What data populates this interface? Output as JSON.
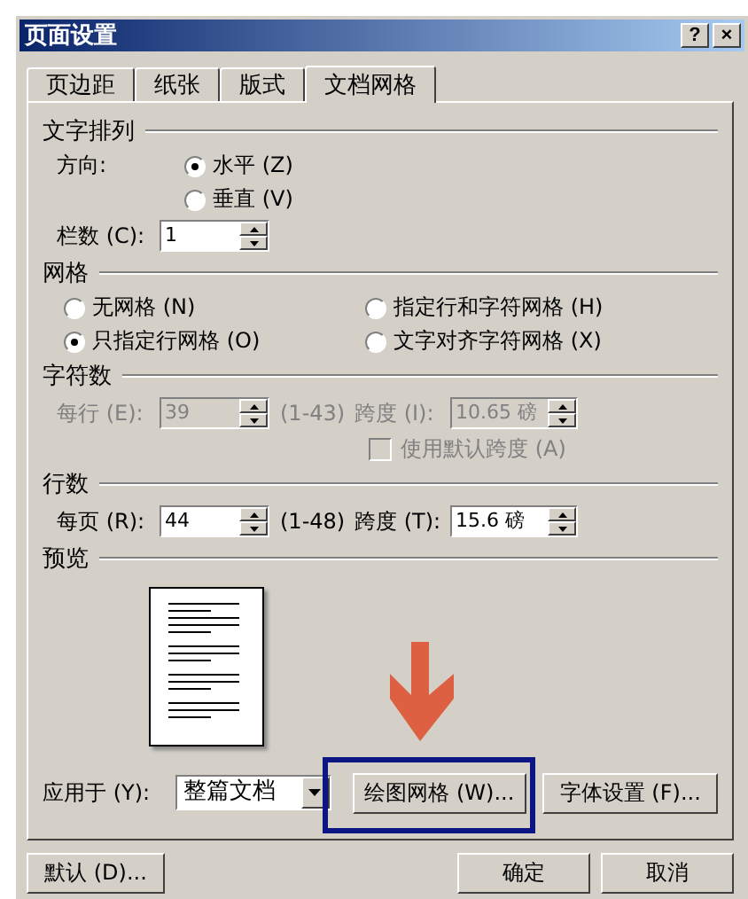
{
  "window": {
    "title": "页面设置",
    "help": "?",
    "close": "×"
  },
  "tabs": [
    {
      "label": "页边距",
      "selected": false
    },
    {
      "label": "纸张",
      "selected": false
    },
    {
      "label": "版式",
      "selected": false
    },
    {
      "label": "文档网格",
      "selected": true
    }
  ],
  "text_direction": {
    "heading": "文字排列",
    "direction_label": "方向:",
    "options": [
      {
        "label": "水平 (Z)",
        "selected": true
      },
      {
        "label": "垂直 (V)",
        "selected": false
      }
    ],
    "columns_label": "栏数 (C):",
    "columns_value": "1"
  },
  "grid": {
    "heading": "网格",
    "options": [
      {
        "label": "无网格 (N)",
        "selected": false
      },
      {
        "label": "指定行和字符网格 (H)",
        "selected": false
      },
      {
        "label": "只指定行网格 (O)",
        "selected": true
      },
      {
        "label": "文字对齐字符网格 (X)",
        "selected": false
      }
    ]
  },
  "characters": {
    "heading": "字符数",
    "disabled": true,
    "per_line_label": "每行 (E):",
    "per_line_value": "39",
    "per_line_range": "(1-43)",
    "pitch_label": "跨度 (I):",
    "pitch_value": "10.65 磅",
    "default_pitch": {
      "label": "使用默认跨度 (A)",
      "checked": false
    }
  },
  "lines": {
    "heading": "行数",
    "disabled": false,
    "per_page_label": "每页 (R):",
    "per_page_value": "44",
    "per_page_range": "(1-48)",
    "pitch_label": "跨度 (T):",
    "pitch_value": "15.6 磅"
  },
  "preview": {
    "heading": "预览"
  },
  "apply_to": {
    "label": "应用于 (Y):",
    "value": "整篇文档"
  },
  "buttons": {
    "drawing_grid": "绘图网格 (W)...",
    "font_settings": "字体设置 (F)...",
    "default": "默认 (D)...",
    "ok": "确定",
    "cancel": "取消"
  }
}
